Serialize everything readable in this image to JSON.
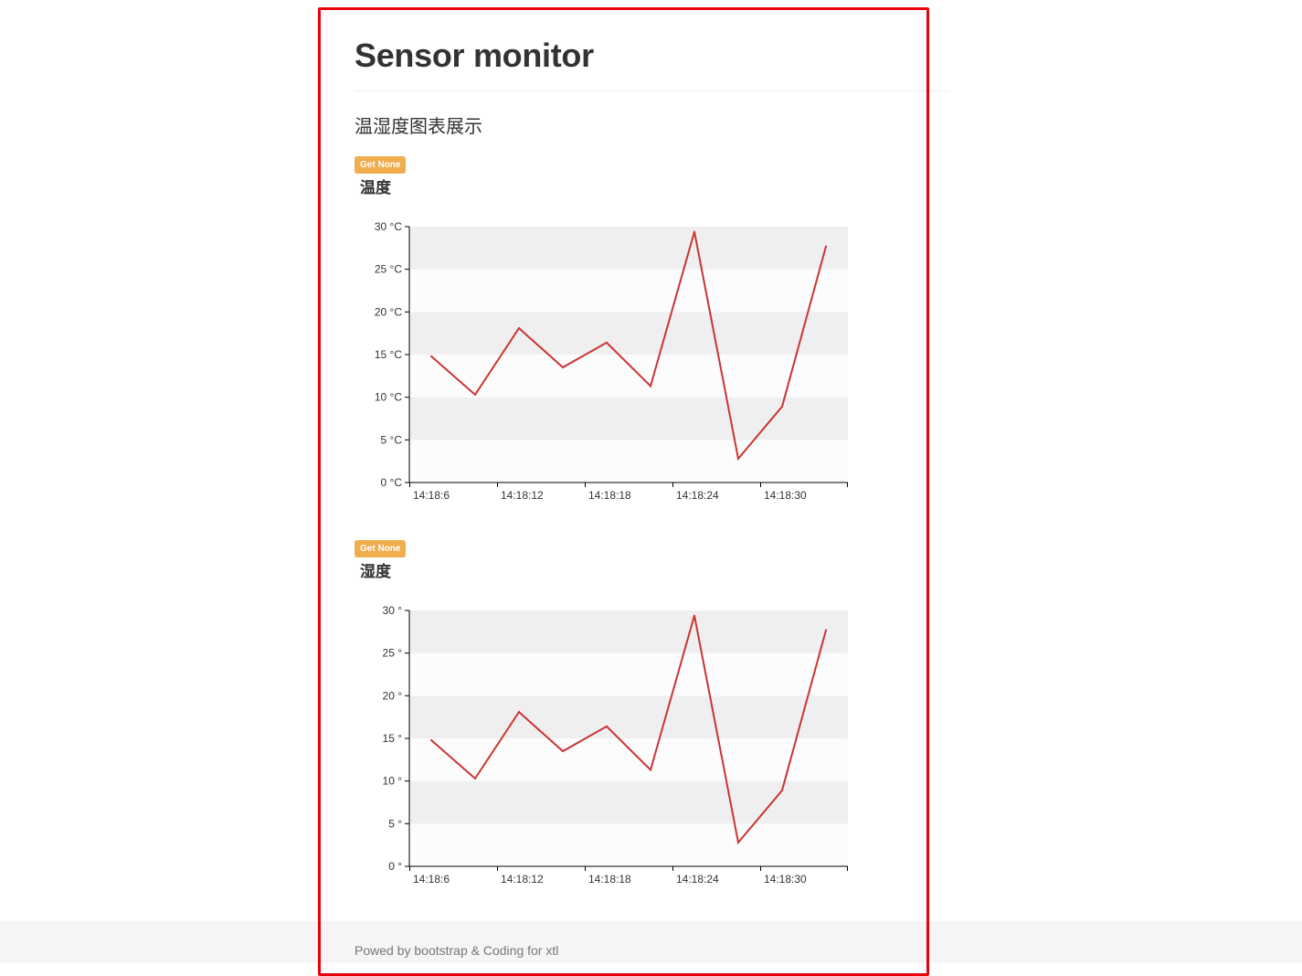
{
  "page": {
    "title": "Sensor monitor",
    "subtitle": "温湿度图表展示",
    "footer": "Powed by bootstrap & Coding for xtl"
  },
  "colors": {
    "line": "#cc3333",
    "badge": "#f0ad4e",
    "highlight": "#e8000b"
  },
  "panels": [
    {
      "badge": "Get None",
      "heading": "温度"
    },
    {
      "badge": "Get None",
      "heading": "湿度"
    }
  ],
  "chart_data": [
    {
      "type": "line",
      "x": [
        "14:18:6",
        "14:18:9",
        "14:18:12",
        "14:18:15",
        "14:18:18",
        "14:18:21",
        "14:18:24",
        "14:18:27",
        "14:18:30",
        "14:18:33"
      ],
      "xticks": [
        "14:18:6",
        "14:18:12",
        "14:18:18",
        "14:18:24",
        "14:18:30"
      ],
      "values": [
        14.8,
        10.3,
        18.1,
        13.5,
        16.4,
        11.3,
        29.4,
        2.8,
        8.9,
        27.7
      ],
      "ylim": [
        0,
        30
      ],
      "yticks": [
        "0 °C",
        "5 °C",
        "10 °C",
        "15 °C",
        "20 °C",
        "25 °C",
        "30 °C"
      ],
      "grid": "alternating bands"
    },
    {
      "type": "line",
      "x": [
        "14:18:6",
        "14:18:9",
        "14:18:12",
        "14:18:15",
        "14:18:18",
        "14:18:21",
        "14:18:24",
        "14:18:27",
        "14:18:30",
        "14:18:33"
      ],
      "xticks": [
        "14:18:6",
        "14:18:12",
        "14:18:18",
        "14:18:24",
        "14:18:30"
      ],
      "values": [
        14.8,
        10.3,
        18.1,
        13.5,
        16.4,
        11.3,
        29.4,
        2.8,
        8.9,
        27.7
      ],
      "ylim": [
        0,
        30
      ],
      "yticks": [
        "0 °",
        "5 °",
        "10 °",
        "15 °",
        "20 °",
        "25 °",
        "30 °"
      ],
      "grid": "alternating bands"
    }
  ]
}
